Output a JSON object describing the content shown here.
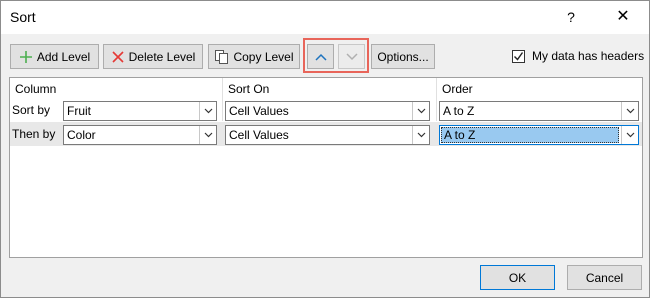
{
  "window": {
    "title": "Sort",
    "help": "?",
    "close": "✕"
  },
  "toolbar": {
    "add_level": "Add Level",
    "delete_level": "Delete Level",
    "copy_level": "Copy Level",
    "options": "Options...",
    "headers_checkbox_label": "My data has headers",
    "headers_checked": true
  },
  "columns": {
    "column": "Column",
    "sort_on": "Sort On",
    "order": "Order"
  },
  "rows": [
    {
      "label": "Sort by",
      "column": "Fruit",
      "sort_on": "Cell Values",
      "order": "A to Z"
    },
    {
      "label": "Then by",
      "column": "Color",
      "sort_on": "Cell Values",
      "order": "A to Z"
    }
  ],
  "footer": {
    "ok": "OK",
    "cancel": "Cancel"
  },
  "colors": {
    "highlight": "#e8655a",
    "add_plus": "#4caf50",
    "delete_x": "#e53935",
    "arrow_up": "#1e73be",
    "selection": "#99c9f0"
  },
  "icons": {
    "add": "plus-icon",
    "delete": "x-icon",
    "copy": "copy-icon",
    "up": "chevron-up-icon",
    "down": "chevron-down-icon"
  }
}
